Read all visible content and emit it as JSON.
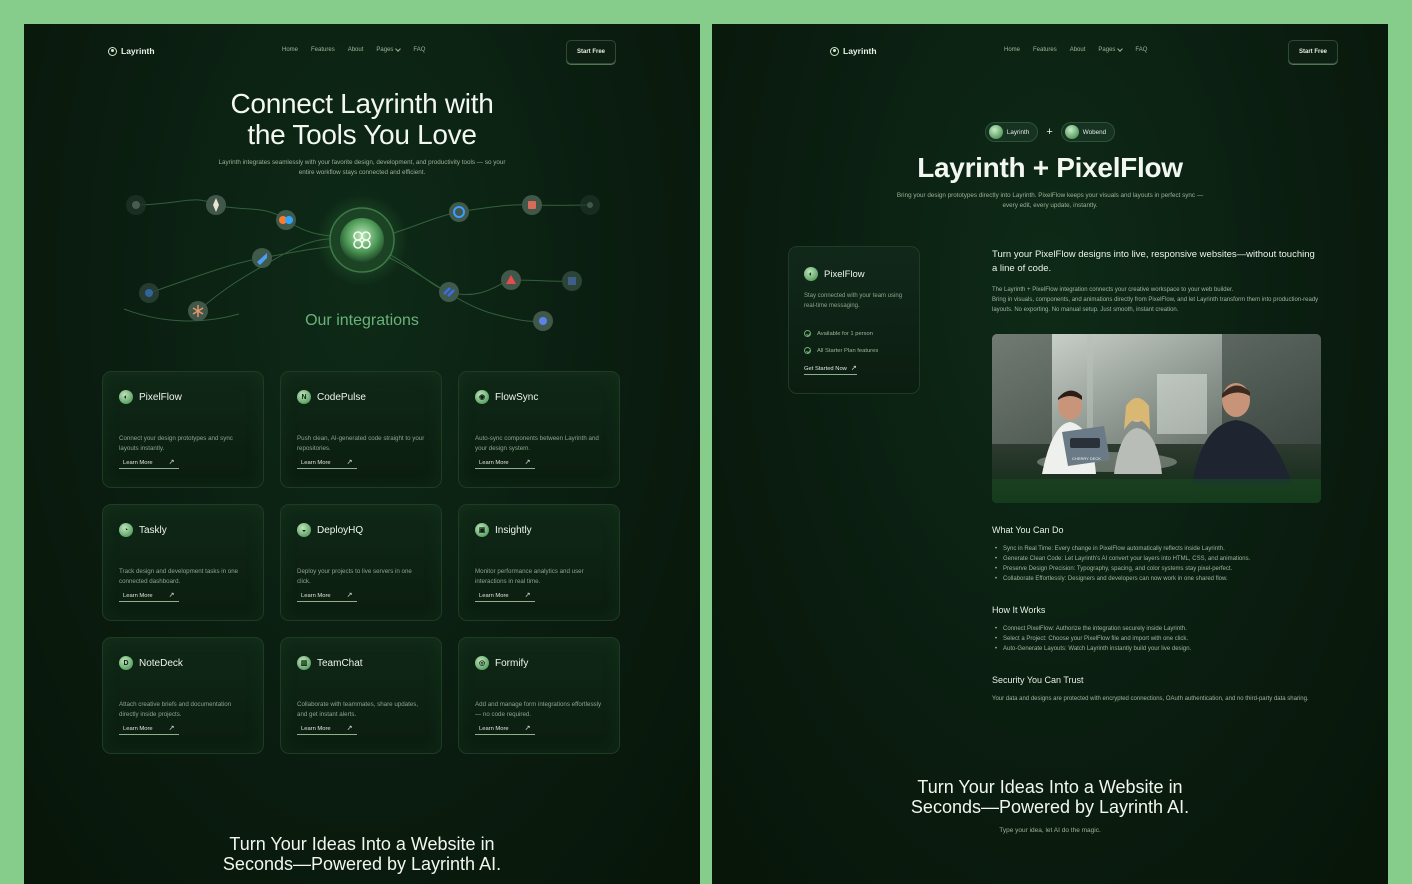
{
  "nav": {
    "brand": "Layrinth",
    "links": [
      "Home",
      "Features",
      "About",
      "Pages",
      "FAQ"
    ],
    "cta": "Start Free"
  },
  "left": {
    "hero_title_line1": "Connect Layrinth with",
    "hero_title_line2": "the Tools You Love",
    "hero_subtitle": "Layrinth integrates seamlessly with your favorite design, development, and productivity tools — so your entire workflow stays connected and efficient.",
    "integrations_title": "Our integrations",
    "cards": [
      {
        "name": "PixelFlow",
        "desc": "Connect your design prototypes and sync layouts instantly.",
        "link": "Learn More"
      },
      {
        "name": "CodePulse",
        "desc": "Push clean, AI-generated code straight to your repositories.",
        "link": "Learn More"
      },
      {
        "name": "FlowSync",
        "desc": "Auto-sync components between Layrinth and your design system.",
        "link": "Learn More"
      },
      {
        "name": "Taskly",
        "desc": "Track design and development tasks in one connected dashboard.",
        "link": "Learn More"
      },
      {
        "name": "DeployHQ",
        "desc": "Deploy your projects to live servers in one click.",
        "link": "Learn More"
      },
      {
        "name": "Insightly",
        "desc": "Monitor performance analytics and user interactions in real time.",
        "link": "Learn More"
      },
      {
        "name": "NoteDeck",
        "desc": "Attach creative briefs and documentation directly inside projects.",
        "link": "Learn More"
      },
      {
        "name": "TeamChat",
        "desc": "Collaborate with teammates, share updates, and get instant alerts.",
        "link": "Learn More"
      },
      {
        "name": "Formify",
        "desc": "Add and manage form integrations effortlessly — no code required.",
        "link": "Learn More"
      }
    ],
    "cta_line1": "Turn Your Ideas Into a Website in",
    "cta_line2": "Seconds—Powered by Layrinth AI."
  },
  "right": {
    "pill_left": "Layrinth",
    "pill_plus": "+",
    "pill_right": "Wobend",
    "title": "Layrinth + PixelFlow",
    "subtitle": "Bring your design prototypes directly into Layrinth. PixelFlow keeps your visuals and layouts in perfect sync — every edit, every update, instantly.",
    "card": {
      "name": "PixelFlow",
      "desc": "Stay connected with your team using real-time messaging.",
      "feature1": "Available for 1 person",
      "feature2": "All Starter Plan features",
      "link": "Get Started Now"
    },
    "intro_heading": "Turn your PixelFlow designs into live, responsive websites—without touching a line of code.",
    "intro_p1": "The Layrinth + PixelFlow integration connects your creative workspace to your web builder.",
    "intro_p2": "Bring in visuals, components, and animations directly from PixelFlow, and let Layrinth transform them into production-ready layouts. No exporting. No manual setup. Just smooth, instant creation.",
    "photo_sign": "CHERRY DECK",
    "what_heading": "What You Can Do",
    "what_items": [
      "Sync in Real Time: Every change in PixelFlow automatically reflects inside Layrinth.",
      "Generate Clean Code: Let Layrinth's AI convert your layers into HTML, CSS, and animations.",
      "Preserve Design Precision: Typography, spacing, and color systems stay pixel-perfect.",
      "Collaborate Effortlessly: Designers and developers can now work in one shared flow."
    ],
    "how_heading": "How It Works",
    "how_items": [
      "Connect PixelFlow: Authorize the integration securely inside Layrinth.",
      "Select a Project: Choose your PixelFlow file and import with one click.",
      "Auto-Generate Layouts: Watch Layrinth instantly build your live design."
    ],
    "security_heading": "Security You Can Trust",
    "security_text": "Your data and designs are protected with encrypted connections, OAuth authentication, and no third-party data sharing.",
    "cta_line1": "Turn Your Ideas Into a Website in",
    "cta_line2": "Seconds—Powered by Layrinth AI.",
    "cta_sub": "Type your idea, let AI do the magic."
  },
  "colors": {
    "background": "#86cc8a",
    "panel": "#0a1d10",
    "accent": "#69b27a",
    "text": "#e8f1e6",
    "muted": "#9cb099"
  }
}
